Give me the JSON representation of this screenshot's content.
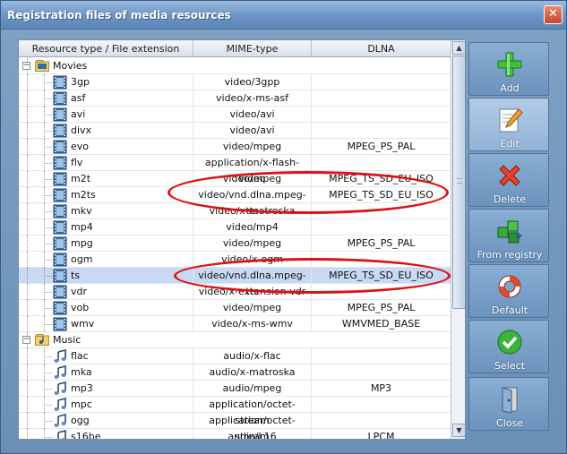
{
  "window": {
    "title": "Registration files of media resources",
    "close_glyph": "✕"
  },
  "grid": {
    "columns": [
      "Resource type / File extension",
      "MIME-type",
      "DLNA"
    ],
    "rows": [
      {
        "type": "group",
        "label": "Movies",
        "icon": "movies-folder-icon",
        "expander": "−"
      },
      {
        "type": "item",
        "icon": "film-icon",
        "ext": "3gp",
        "mime": "video/3gpp",
        "dlna": ""
      },
      {
        "type": "item",
        "icon": "film-icon",
        "ext": "asf",
        "mime": "video/x-ms-asf",
        "dlna": ""
      },
      {
        "type": "item",
        "icon": "film-icon",
        "ext": "avi",
        "mime": "video/avi",
        "dlna": ""
      },
      {
        "type": "item",
        "icon": "film-icon",
        "ext": "divx",
        "mime": "video/avi",
        "dlna": ""
      },
      {
        "type": "item",
        "icon": "film-icon",
        "ext": "evo",
        "mime": "video/mpeg",
        "dlna": "MPEG_PS_PAL"
      },
      {
        "type": "item",
        "icon": "film-icon",
        "ext": "flv",
        "mime": "application/x-flash-video",
        "dlna": ""
      },
      {
        "type": "item",
        "icon": "film-icon",
        "ext": "m2t",
        "mime": "video/mpeg",
        "dlna": "MPEG_TS_SD_EU_ISO"
      },
      {
        "type": "item",
        "icon": "film-icon",
        "ext": "m2ts",
        "mime": "video/vnd.dlna.mpeg-tts",
        "dlna": "MPEG_TS_SD_EU_ISO"
      },
      {
        "type": "item",
        "icon": "film-icon",
        "ext": "mkv",
        "mime": "video/x-matroska",
        "dlna": ""
      },
      {
        "type": "item",
        "icon": "film-icon",
        "ext": "mp4",
        "mime": "video/mp4",
        "dlna": ""
      },
      {
        "type": "item",
        "icon": "film-icon",
        "ext": "mpg",
        "mime": "video/mpeg",
        "dlna": "MPEG_PS_PAL"
      },
      {
        "type": "item",
        "icon": "film-icon",
        "ext": "ogm",
        "mime": "video/x-ogm",
        "dlna": ""
      },
      {
        "type": "item",
        "icon": "film-icon",
        "ext": "ts",
        "mime": "video/vnd.dlna.mpeg-tts",
        "dlna": "MPEG_TS_SD_EU_ISO",
        "selected": true
      },
      {
        "type": "item",
        "icon": "film-icon",
        "ext": "vdr",
        "mime": "video/x-extension-vdr",
        "dlna": ""
      },
      {
        "type": "item",
        "icon": "film-icon",
        "ext": "vob",
        "mime": "video/mpeg",
        "dlna": "MPEG_PS_PAL"
      },
      {
        "type": "item",
        "icon": "film-icon",
        "ext": "wmv",
        "mime": "video/x-ms-wmv",
        "dlna": "WMVMED_BASE"
      },
      {
        "type": "group",
        "label": "Music",
        "icon": "music-folder-icon",
        "expander": "−"
      },
      {
        "type": "item",
        "icon": "music-note-icon",
        "ext": "flac",
        "mime": "audio/x-flac",
        "dlna": ""
      },
      {
        "type": "item",
        "icon": "music-note-icon",
        "ext": "mka",
        "mime": "audio/x-matroska",
        "dlna": ""
      },
      {
        "type": "item",
        "icon": "music-note-icon",
        "ext": "mp3",
        "mime": "audio/mpeg",
        "dlna": "MP3"
      },
      {
        "type": "item",
        "icon": "music-note-icon",
        "ext": "mpc",
        "mime": "application/octet-stream",
        "dlna": ""
      },
      {
        "type": "item",
        "icon": "music-note-icon",
        "ext": "ogg",
        "mime": "application/octet-stream",
        "dlna": ""
      },
      {
        "type": "item",
        "icon": "music-note-icon",
        "ext": "s16be",
        "mime": "audio/L16",
        "dlna": "LPCM"
      }
    ]
  },
  "toolbar": {
    "buttons": [
      {
        "name": "add-button",
        "label": "Add",
        "icon": "plus-icon"
      },
      {
        "name": "edit-button",
        "label": "Edit",
        "icon": "edit-icon",
        "active": true
      },
      {
        "name": "delete-button",
        "label": "Delete",
        "icon": "delete-x-icon"
      },
      {
        "name": "from-registry-button",
        "label": "From registry",
        "icon": "registry-cubes-icon"
      },
      {
        "name": "default-button",
        "label": "Default",
        "icon": "lifebuoy-icon"
      },
      {
        "name": "select-button",
        "label": "Select",
        "icon": "checkmark-icon"
      },
      {
        "name": "close-button",
        "label": "Close",
        "icon": "exit-door-icon"
      }
    ]
  },
  "colors": {
    "accent": "#6a90b6",
    "selection": "#c8d9f3",
    "annotation": "#dd1111"
  }
}
